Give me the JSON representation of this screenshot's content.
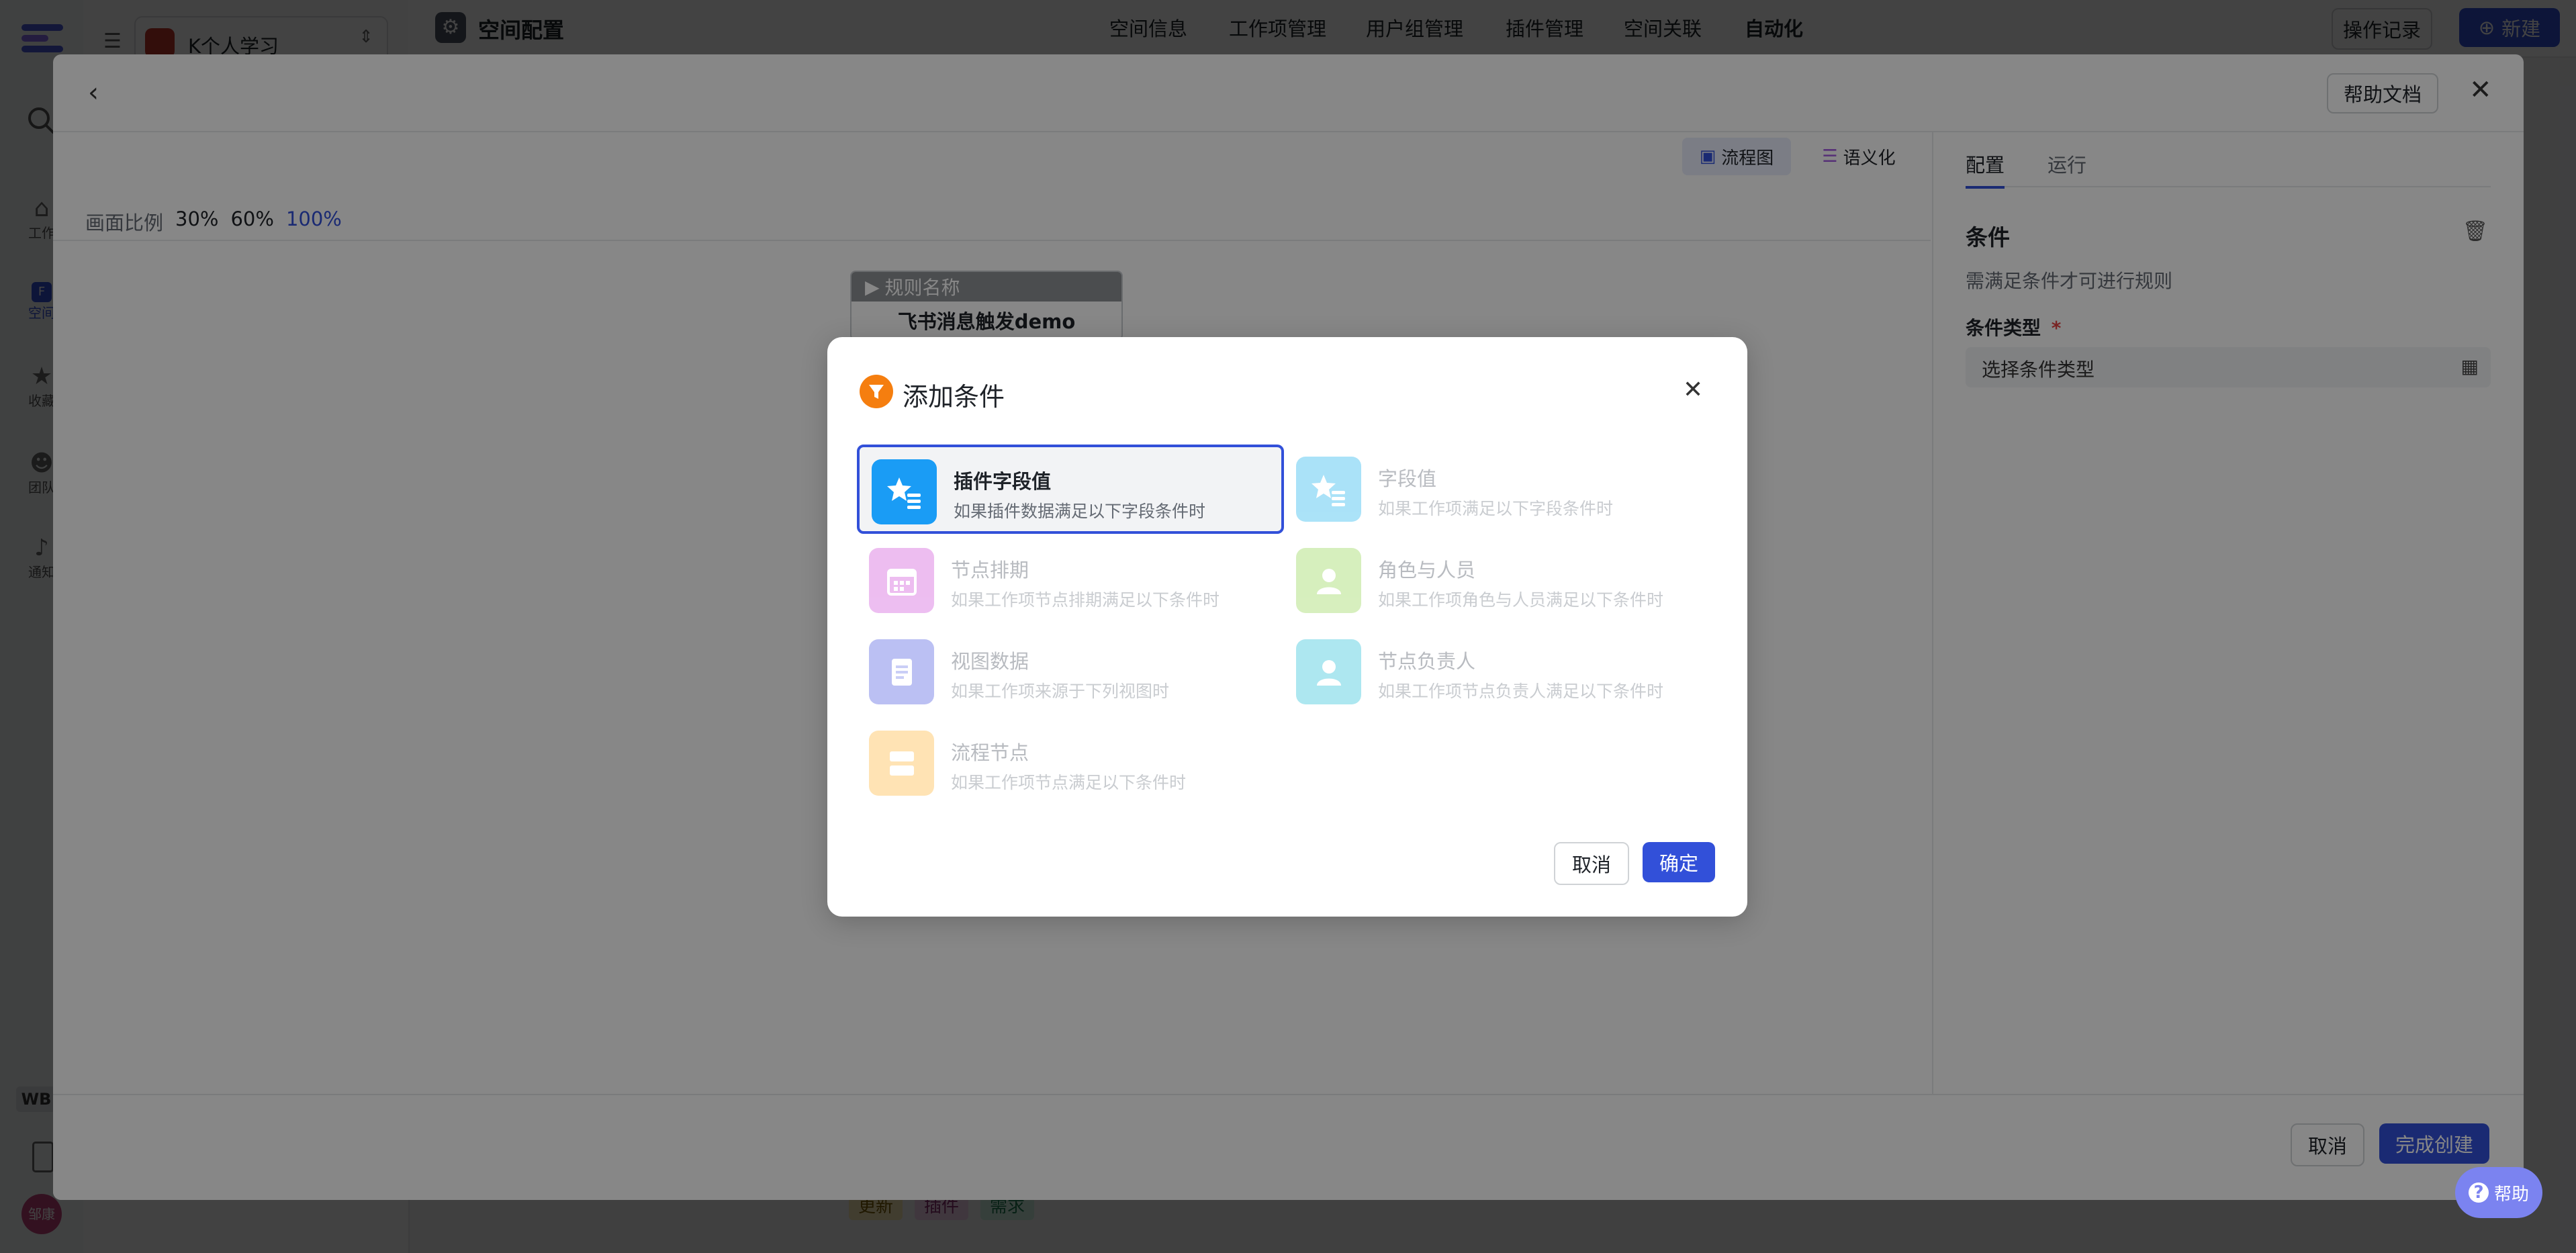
{
  "background": {
    "project_name": "K个人学习",
    "space_title": "空间配置",
    "nav_tabs": [
      "空间信息",
      "工作项管理",
      "用户组管理",
      "插件管理",
      "空间关联",
      "自动化"
    ],
    "btn_operation_log": "操作记录",
    "btn_new": "新建",
    "rail_labels": [
      "工作",
      "空间",
      "收藏",
      "团队",
      "通知"
    ],
    "rail_badge": "WB",
    "avatar_text": "邹康",
    "bottom_tags": [
      "更新",
      "插件",
      "需求"
    ]
  },
  "drawer": {
    "help_doc": "帮助文档",
    "view_flow": "流程图",
    "view_semantic": "语义化",
    "zoom_label": "画面比例",
    "zoom_options": [
      "30%",
      "60%",
      "100%"
    ],
    "zoom_active": "100%",
    "rule_card": {
      "header": "规则名称",
      "name": "飞书消息触发demo"
    },
    "right_tabs": [
      "配置",
      "运行"
    ],
    "condition_title": "条件",
    "condition_desc": "需满足条件才可进行规则",
    "condition_type_label": "条件类型",
    "required_mark": "*",
    "condition_type_placeholder": "选择条件类型",
    "footer_cancel": "取消",
    "footer_finish": "完成创建",
    "help": "帮助"
  },
  "modal": {
    "title": "添加条件",
    "options": [
      {
        "title": "插件字段值",
        "desc": "如果插件数据满足以下字段条件时",
        "icon": "star-list-icon",
        "color": "#1a9cf5",
        "selected": true,
        "enabled": true
      },
      {
        "title": "字段值",
        "desc": "如果工作项满足以下字段条件时",
        "icon": "star-list-icon",
        "color": "#45c1f0",
        "selected": false,
        "enabled": false
      },
      {
        "title": "节点排期",
        "desc": "如果工作项节点排期满足以下条件时",
        "icon": "calendar-icon",
        "color": "#d86fe0",
        "selected": false,
        "enabled": false
      },
      {
        "title": "角色与人员",
        "desc": "如果工作项角色与人员满足以下条件时",
        "icon": "user-icon",
        "color": "#a6dc6e",
        "selected": false,
        "enabled": false
      },
      {
        "title": "视图数据",
        "desc": "如果工作项来源于下列视图时",
        "icon": "document-icon",
        "color": "#6b75e6",
        "selected": false,
        "enabled": false
      },
      {
        "title": "节点负责人",
        "desc": "如果工作项节点负责人满足以下条件时",
        "icon": "user-icon",
        "color": "#4ccbe0",
        "selected": false,
        "enabled": false
      },
      {
        "title": "流程节点",
        "desc": "如果工作项节点满足以下条件时",
        "icon": "flow-node-icon",
        "color": "#ffc35a",
        "selected": false,
        "enabled": false
      }
    ],
    "cancel": "取消",
    "confirm": "确定"
  },
  "colors": {
    "primary": "#3250d9",
    "orange": "#f57e0f"
  }
}
